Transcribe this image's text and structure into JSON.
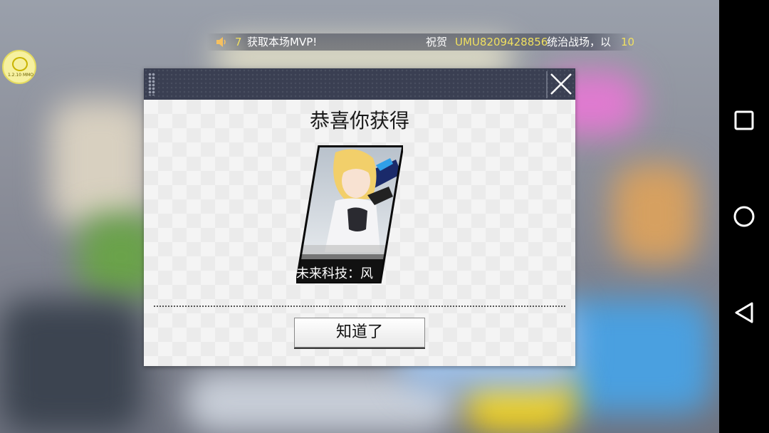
{
  "announcement": {
    "count": "7",
    "text_a": "获取本场MVP!",
    "text_b": "祝贺",
    "user": "UMU8209428856",
    "text_c": "统治战场，以",
    "count2": "10"
  },
  "logo": {
    "text": "1.2.10 MMO"
  },
  "dialog": {
    "title": "恭喜你获得",
    "reward_name": "未来科技：风",
    "confirm_label": "知道了"
  },
  "icons": [
    "speaker-icon",
    "close-icon",
    "recents-icon",
    "home-icon",
    "back-icon"
  ],
  "colors": {
    "header": "#3a3f52",
    "highlight": "#f0e060",
    "navbar": "#000000"
  }
}
